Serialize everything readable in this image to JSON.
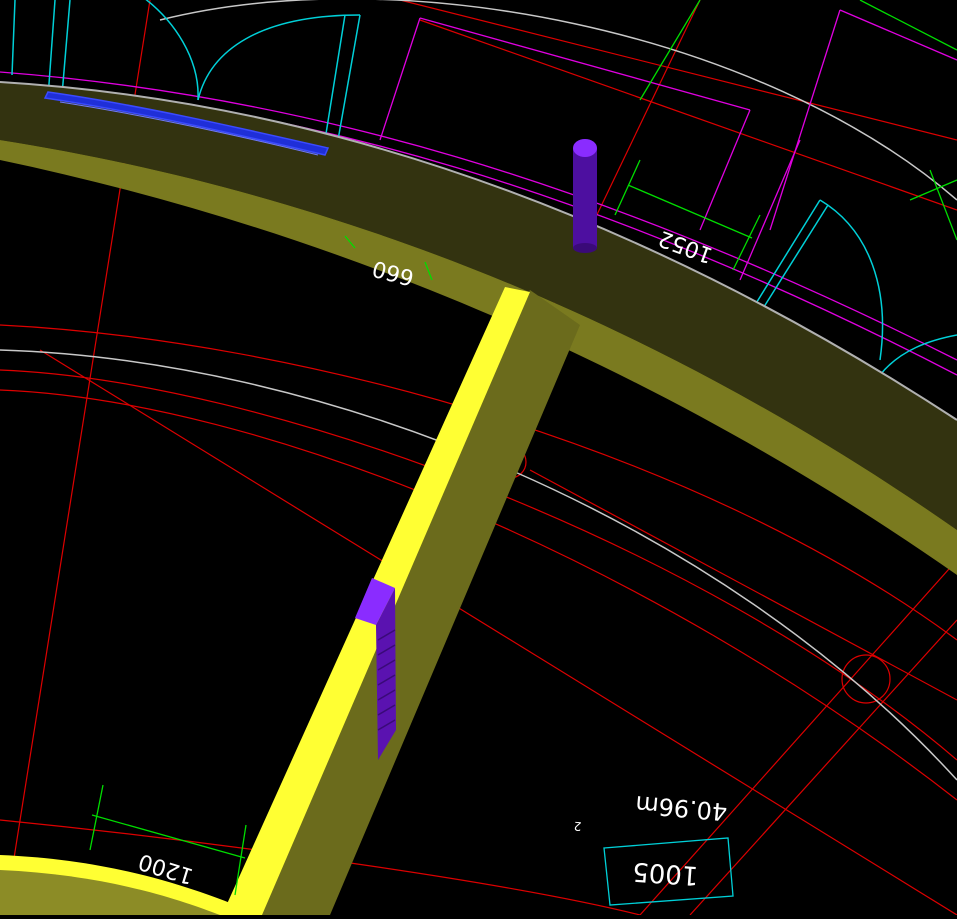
{
  "dimensions": {
    "d660": "660",
    "d1052": "1052",
    "d1200": "1200"
  },
  "room": {
    "area_value": "40.96m",
    "area_superscript": "2",
    "number": "1005"
  },
  "colors": {
    "background": "#000000",
    "wall_dark": "#333310",
    "wall_mid": "#6b6b1c",
    "wall_light": "#8c8c26",
    "wall_highlight": "#ffff33",
    "column": "#5a12b0",
    "column_top": "#8a2cff",
    "window_glass": "#1f2fd8",
    "cad_red": "#dd0000",
    "cad_magenta": "#e000e0",
    "cad_cyan": "#00d0d8",
    "cad_green": "#00dd00",
    "cad_white": "#c8c8c8"
  }
}
